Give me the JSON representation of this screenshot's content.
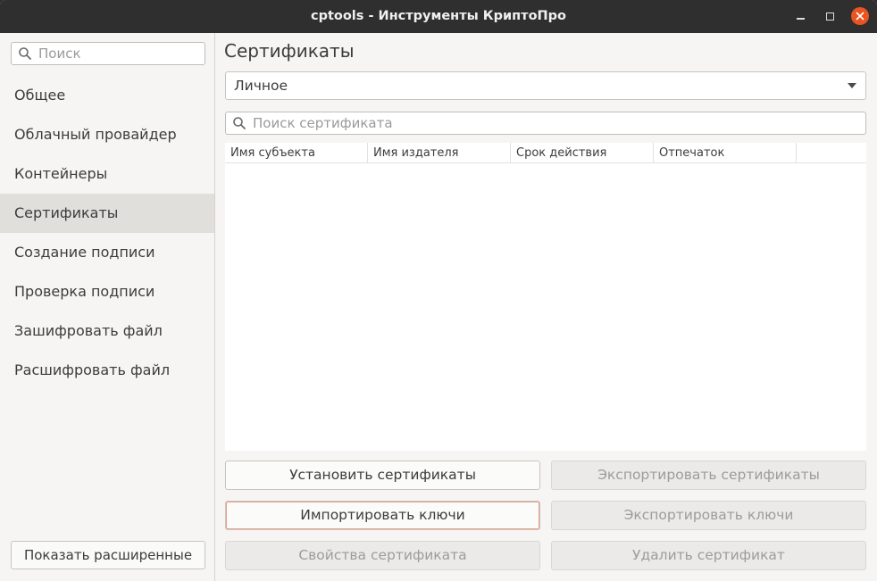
{
  "window": {
    "title": "cptools - Инструменты КриптоПро"
  },
  "sidebar": {
    "search_placeholder": "Поиск",
    "items": [
      {
        "label": "Общее"
      },
      {
        "label": "Облачный провайдер"
      },
      {
        "label": "Контейнеры"
      },
      {
        "label": "Сертификаты"
      },
      {
        "label": "Создание подписи"
      },
      {
        "label": "Проверка подписи"
      },
      {
        "label": "Зашифровать файл"
      },
      {
        "label": "Расшифровать файл"
      }
    ],
    "active_index": 3,
    "advanced_button": "Показать расширенные"
  },
  "main": {
    "title": "Сертификаты",
    "store_select": "Личное",
    "search_placeholder": "Поиск сертификата",
    "columns": [
      "Имя субъекта",
      "Имя издателя",
      "Срок действия",
      "Отпечаток"
    ],
    "rows": [],
    "buttons": {
      "install": "Установить сертификаты",
      "export_certs": "Экспортировать сертификаты",
      "import_keys": "Импортировать ключи",
      "export_keys": "Экспортировать ключи",
      "properties": "Свойства сертификата",
      "delete": "Удалить сертификат"
    }
  },
  "colors": {
    "accent": "#e95420",
    "titlebar": "#2f2f2f",
    "sidebar_active": "#e1dfdc"
  },
  "icons": {
    "search": "search-icon",
    "minimize": "minimize-icon",
    "maximize": "maximize-icon",
    "close": "close-icon",
    "dropdown": "chevron-down-icon"
  }
}
